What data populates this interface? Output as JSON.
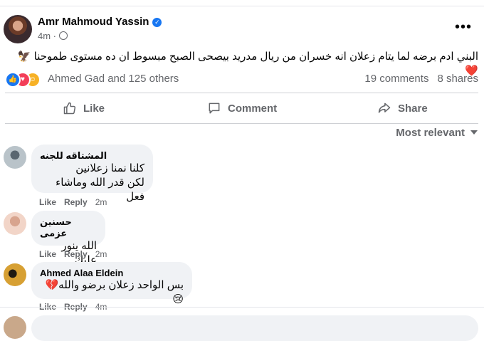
{
  "post": {
    "author": "Amr Mahmoud Yassin",
    "time": "4m",
    "text": "البني ادم برضه لما يتام زعلان انه خسران  من ريال مدريد  بيصحى الصبح مبسوط ان ده مستوى طموحنا 🦅❤️",
    "reactions_text": "Ahmed Gad and 125 others",
    "comments_count": "19 comments",
    "shares_count": "8 shares"
  },
  "actions": {
    "like": "Like",
    "comment": "Comment",
    "share": "Share"
  },
  "sort": {
    "label": "Most relevant"
  },
  "comments": [
    {
      "name": "المشتاقه للجنه",
      "lines": [
        "كلنا نمنا زعلانين",
        "لكن قدر الله وماشاء فعل"
      ],
      "like": "Like",
      "reply": "Reply",
      "time": "2m"
    },
    {
      "name": "حسنين عزمى",
      "lines": [
        "الله ينور عليك"
      ],
      "like": "Like",
      "reply": "Reply",
      "time": "2m"
    },
    {
      "name": "Ahmed Alaa Eldein",
      "lines": [
        "بس الواحد زعلان برضو والله💔😢"
      ],
      "like": "Like",
      "reply": "Reply",
      "time": "4m"
    }
  ],
  "colors": {
    "accent": "#1877f2",
    "secondary_text": "#65676b",
    "bubble": "#f0f2f5"
  },
  "icons": [
    "verified-badge-icon",
    "globe-icon",
    "more-options-icon",
    "like-reaction-icon",
    "love-reaction-icon",
    "haha-reaction-icon",
    "thumbs-up-icon",
    "comment-icon",
    "share-icon",
    "chevron-down-icon"
  ]
}
